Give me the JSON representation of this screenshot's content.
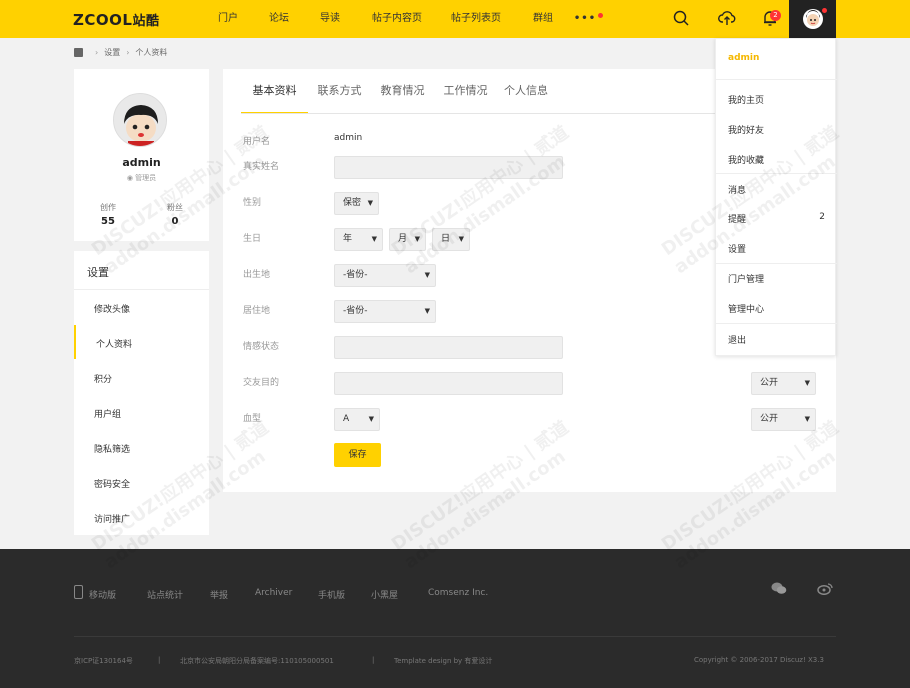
{
  "header": {
    "logo_latin": "ZCOOL",
    "logo_cn": "站酷",
    "nav": [
      "门户",
      "论坛",
      "导读",
      "帖子内容页",
      "帖子列表页",
      "群组"
    ],
    "more": "•••",
    "notification_count": "2",
    "accent_color": "#ffd100"
  },
  "breadcrumb": {
    "items": [
      "设置",
      "个人资料"
    ]
  },
  "profile": {
    "name": "admin",
    "role": "管理员",
    "stats": [
      {
        "label": "创作",
        "value": "55"
      },
      {
        "label": "粉丝",
        "value": "0"
      }
    ]
  },
  "settings": {
    "title": "设置",
    "items": [
      "修改头像",
      "个人资料",
      "积分",
      "用户组",
      "隐私筛选",
      "密码安全",
      "访问推广"
    ],
    "active_index": 1
  },
  "tabs": [
    "基本资料",
    "联系方式",
    "教育情况",
    "工作情况",
    "个人信息"
  ],
  "form": {
    "username_label": "用户名",
    "username_value": "admin",
    "realname_label": "真实姓名",
    "gender_label": "性别",
    "gender_value": "保密",
    "birthday_label": "生日",
    "birthday_year": "年",
    "birthday_month": "月",
    "birthday_day": "日",
    "birthplace_label": "出生地",
    "birthplace_value": "-省份-",
    "residence_label": "居住地",
    "residence_value": "-省份-",
    "relationship_label": "情感状态",
    "purpose_label": "交友目的",
    "purpose_privacy": "公开",
    "blood_label": "血型",
    "blood_value": "A",
    "blood_privacy": "公开",
    "save_label": "保存"
  },
  "dropdown": {
    "username": "admin",
    "items": [
      "我的主页",
      "我的好友",
      "我的收藏",
      "消息",
      "提醒",
      "设置",
      "门户管理",
      "管理中心",
      "退出"
    ],
    "reminder_count": "2"
  },
  "footer": {
    "links": [
      "移动版",
      "站点统计",
      "举报",
      "Archiver",
      "手机版",
      "小黑屋",
      "Comsenz Inc."
    ],
    "icp": "京ICP证130164号",
    "divider": "|",
    "police": "北京市公安局朝阳分局备案编号:110105000501",
    "template": "Template design by 有爱设计",
    "copyright": "Copyright © 2006-2017 Discuz! X3.3"
  },
  "watermark": {
    "text": "DISCUZ!应用中心 | 贰道",
    "domain": "addon.dismall.com"
  }
}
